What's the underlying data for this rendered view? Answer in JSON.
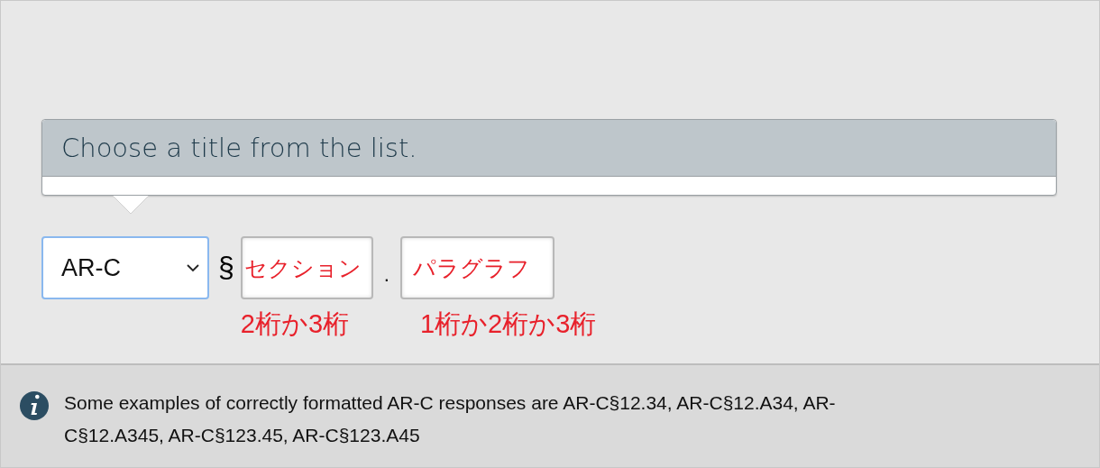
{
  "tooltip": {
    "text": "Choose a title from the list."
  },
  "form": {
    "title_select": {
      "value": "AR-C"
    },
    "section_sign": "§",
    "separator": ".",
    "fields": [
      {
        "placeholder": "セクション",
        "hint": "2桁か3桁"
      },
      {
        "placeholder": "パラグラフ",
        "hint": "1桁か2桁か3桁"
      }
    ]
  },
  "info": {
    "text": "Some examples of correctly formatted AR-C responses are AR-C§12.34, AR-C§12.A34, AR-C§12.A345, AR-C§123.45, AR-C§123.A45"
  }
}
